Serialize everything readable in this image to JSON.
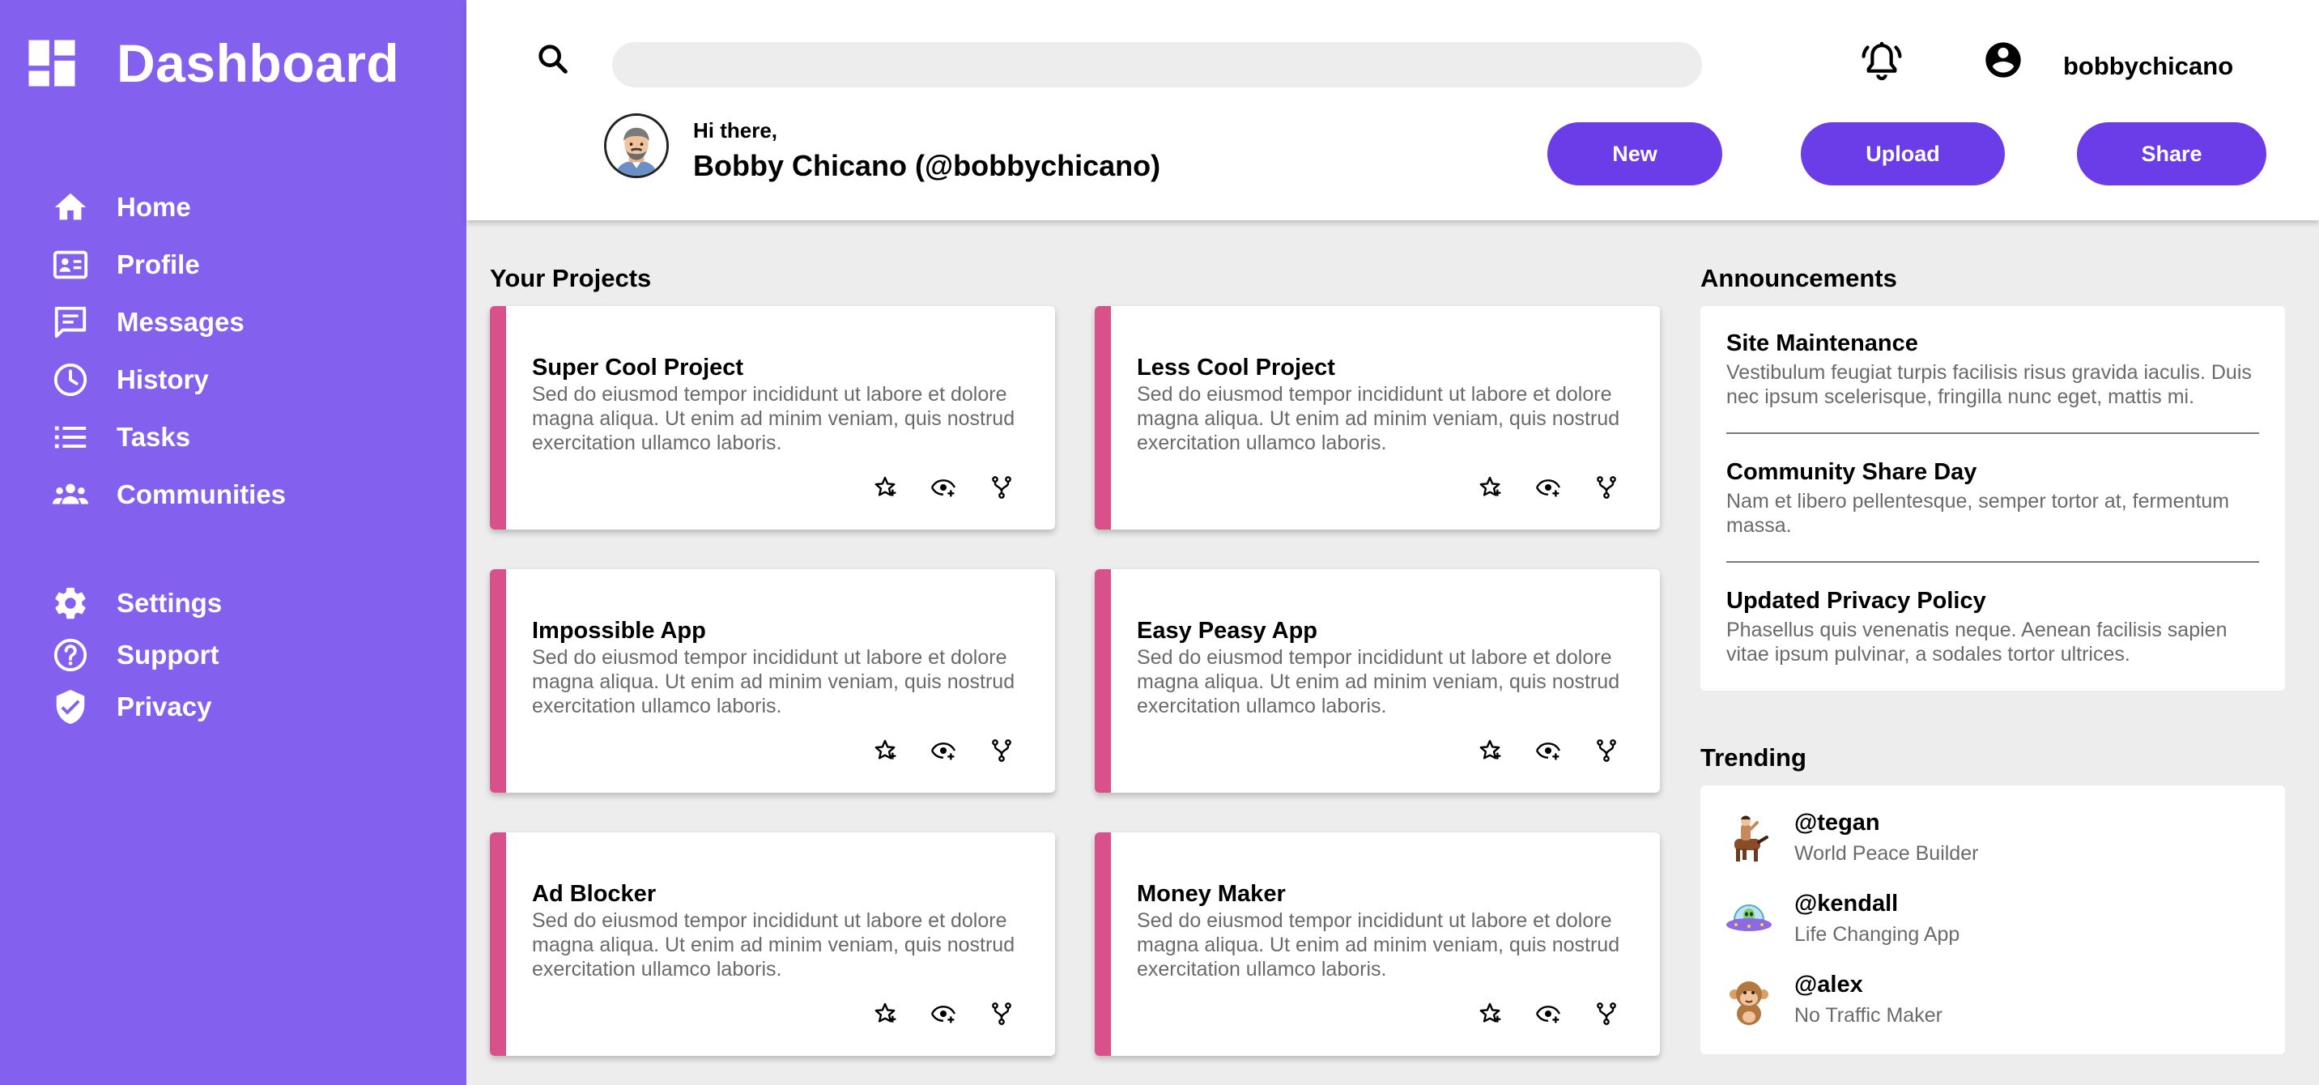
{
  "brand": {
    "title": "Dashboard"
  },
  "nav": {
    "primary": [
      {
        "label": "Home",
        "icon": "home-icon"
      },
      {
        "label": "Profile",
        "icon": "profile-card-icon"
      },
      {
        "label": "Messages",
        "icon": "message-icon"
      },
      {
        "label": "History",
        "icon": "clock-icon"
      },
      {
        "label": "Tasks",
        "icon": "list-icon"
      },
      {
        "label": "Communities",
        "icon": "people-icon"
      }
    ],
    "secondary": [
      {
        "label": "Settings",
        "icon": "gear-icon"
      },
      {
        "label": "Support",
        "icon": "help-icon"
      },
      {
        "label": "Privacy",
        "icon": "shield-icon"
      }
    ]
  },
  "header": {
    "search": {
      "value": "",
      "placeholder": ""
    },
    "username": "bobbychicano",
    "greeting": "Hi there,",
    "full_name": "Bobby Chicano (@bobbychicano)",
    "buttons": {
      "new": "New",
      "upload": "Upload",
      "share": "Share"
    }
  },
  "projects": {
    "title": "Your Projects",
    "items": [
      {
        "title": "Super Cool Project",
        "desc": "Sed do eiusmod tempor incididunt ut labore et dolore magna aliqua. Ut enim ad minim veniam, quis nostrud exercitation ullamco laboris."
      },
      {
        "title": "Less Cool Project",
        "desc": "Sed do eiusmod tempor incididunt ut labore et dolore magna aliqua. Ut enim ad minim veniam, quis nostrud exercitation ullamco laboris."
      },
      {
        "title": "Impossible App",
        "desc": "Sed do eiusmod tempor incididunt ut labore et dolore magna aliqua. Ut enim ad minim veniam, quis nostrud exercitation ullamco laboris."
      },
      {
        "title": "Easy Peasy App",
        "desc": "Sed do eiusmod tempor incididunt ut labore et dolore magna aliqua. Ut enim ad minim veniam, quis nostrud exercitation ullamco laboris."
      },
      {
        "title": "Ad Blocker",
        "desc": "Sed do eiusmod tempor incididunt ut labore et dolore magna aliqua. Ut enim ad minim veniam, quis nostrud exercitation ullamco laboris."
      },
      {
        "title": "Money Maker",
        "desc": "Sed do eiusmod tempor incididunt ut labore et dolore magna aliqua. Ut enim ad minim veniam, quis nostrud exercitation ullamco laboris."
      }
    ],
    "action_icons": [
      "star-add-icon",
      "watch-icon",
      "fork-icon"
    ]
  },
  "announcements": {
    "title": "Announcements",
    "items": [
      {
        "title": "Site Maintenance",
        "desc": "Vestibulum feugiat turpis facilisis risus gravida iaculis. Duis nec ipsum scelerisque, fringilla nunc eget, mattis mi."
      },
      {
        "title": "Community Share Day",
        "desc": "Nam et libero pellentesque, semper tortor at, fermentum massa."
      },
      {
        "title": "Updated Privacy Policy",
        "desc": "Phasellus quis venenatis neque. Aenean facilisis sapien vitae ipsum pulvinar, a sodales tortor ultrices."
      }
    ]
  },
  "trending": {
    "title": "Trending",
    "items": [
      {
        "handle": "@tegan",
        "project": "World Peace Builder",
        "icon": "centaur-icon"
      },
      {
        "handle": "@kendall",
        "project": "Life Changing App",
        "icon": "alien-ufo-icon"
      },
      {
        "handle": "@alex",
        "project": "No Traffic Maker",
        "icon": "monkey-icon"
      }
    ]
  },
  "colors": {
    "sidebar": "#8361ee",
    "button": "#6a3de8",
    "card_accent": "#d9518a",
    "background": "#ededed"
  }
}
